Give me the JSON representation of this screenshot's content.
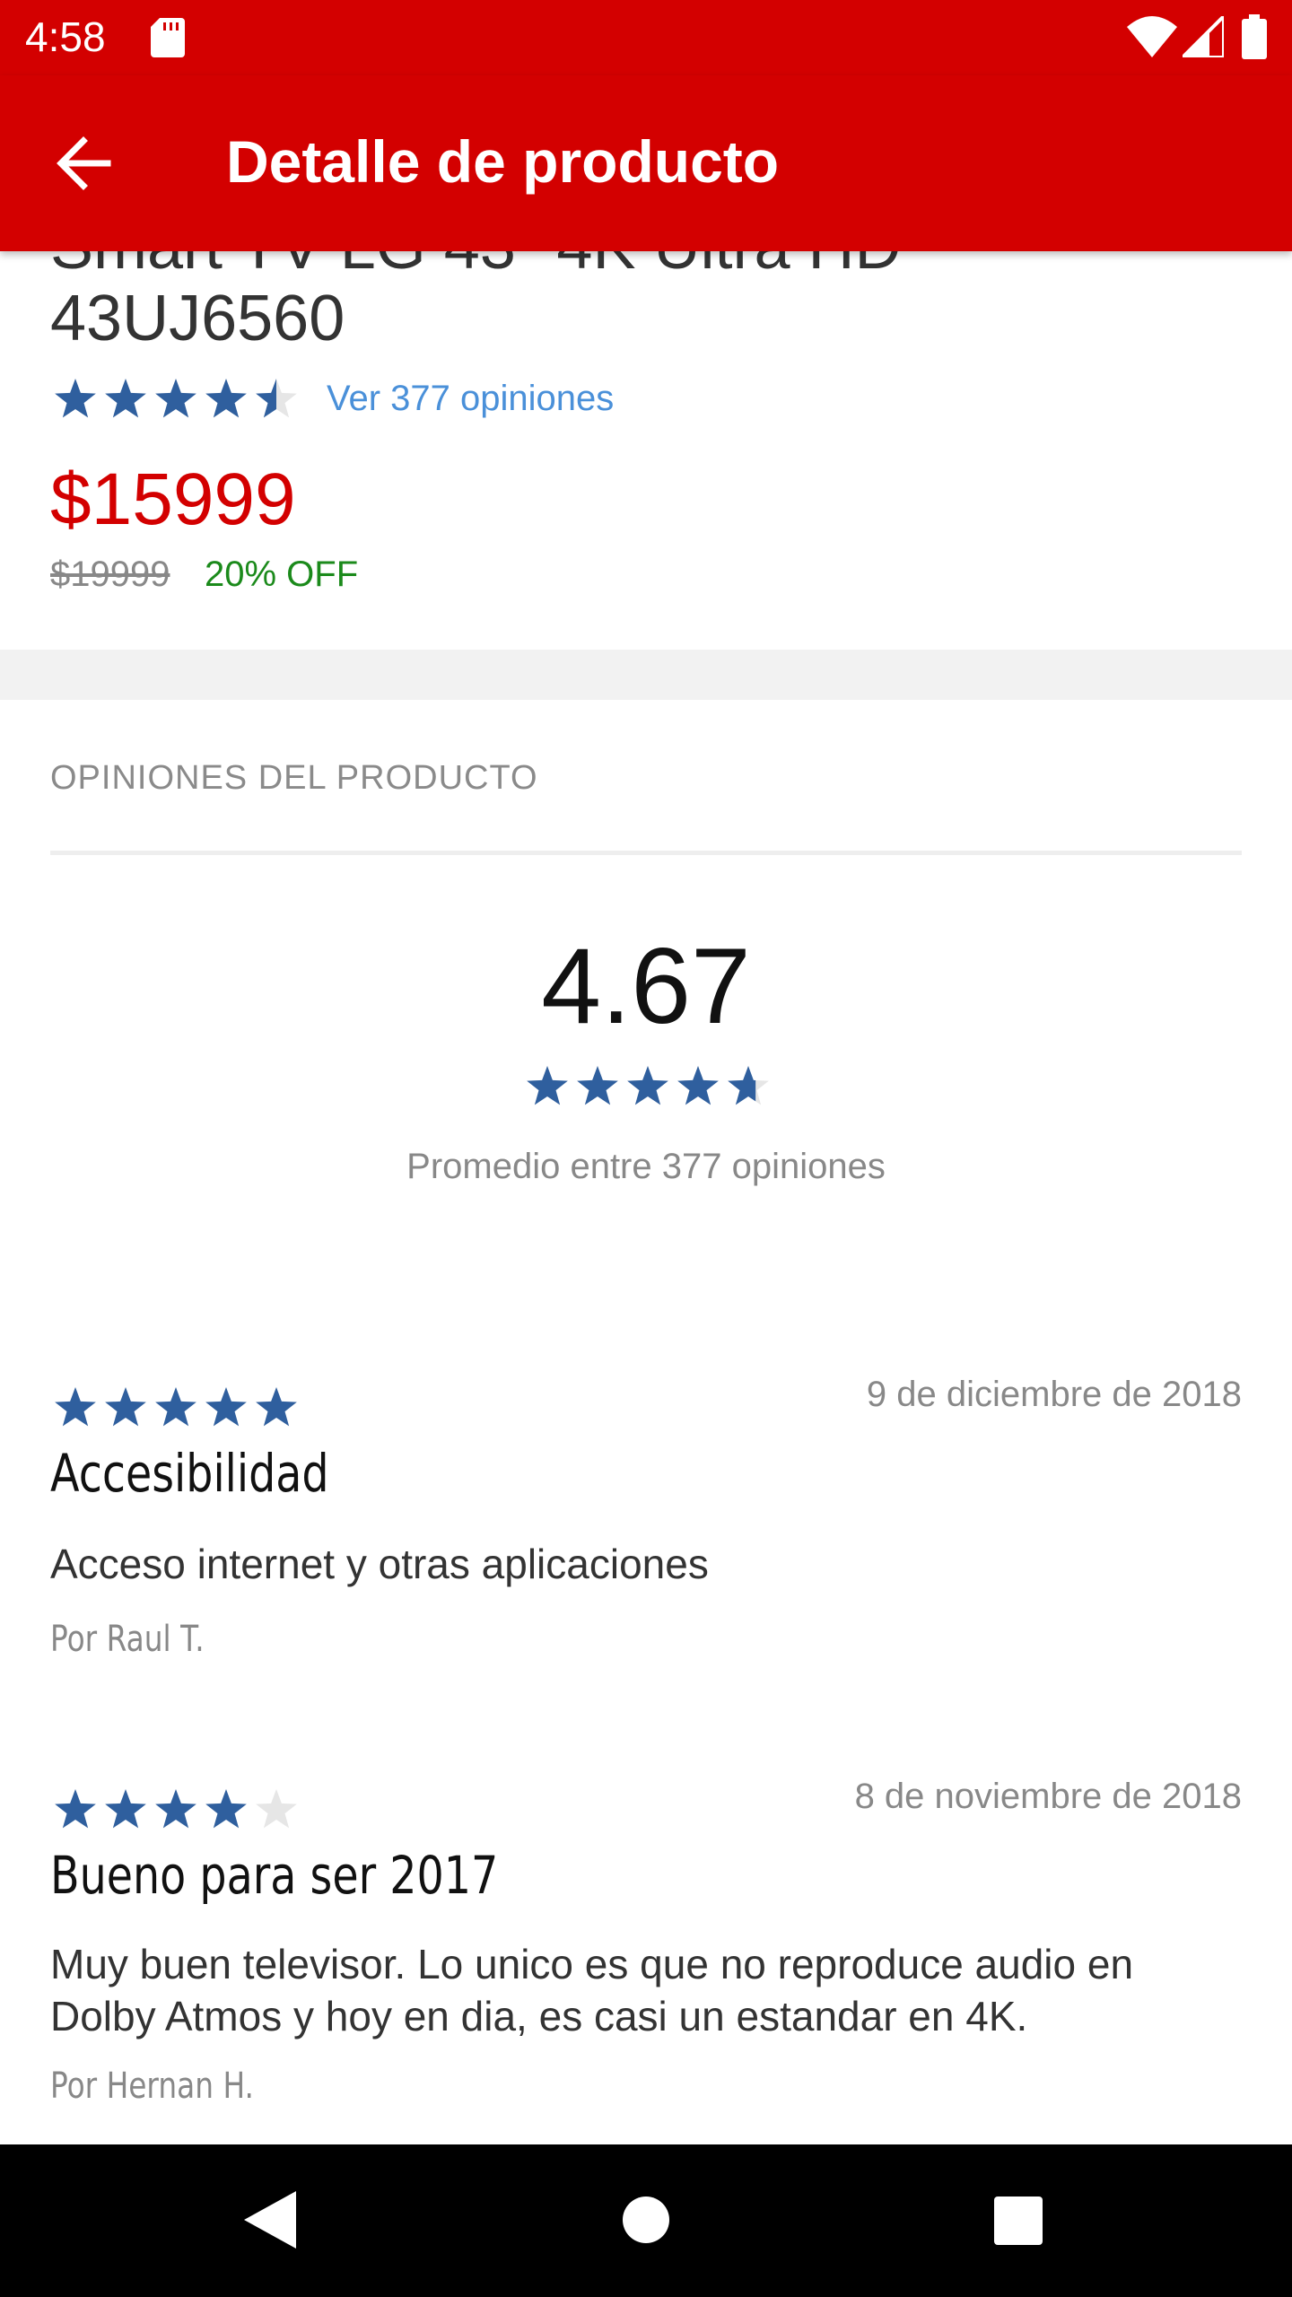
{
  "status_bar": {
    "time": "4:58"
  },
  "app_bar": {
    "title": "Detalle de producto"
  },
  "product": {
    "title_partial": "Smart TV LG 43\" 4K Ultra HD",
    "model": "43UJ6560",
    "rating": 4.5,
    "reviews_link": "Ver 377 opiniones",
    "price": "$15999",
    "old_price": "$19999",
    "discount": "20% OFF"
  },
  "reviews_section": {
    "heading": "OPINIONES DEL PRODUCTO",
    "average": "4.67",
    "average_rating": 4.67,
    "caption": "Promedio entre 377 opiniones"
  },
  "reviews": [
    {
      "rating": 5,
      "date": "9 de diciembre de 2018",
      "title": "Accesibilidad",
      "body": "Acceso internet y otras aplicaciones",
      "author": "Por Raul T."
    },
    {
      "rating": 4,
      "date": "8 de noviembre de 2018",
      "title": "Bueno para ser 2017",
      "body": "Muy buen televisor. Lo unico es que no reproduce audio en Dolby Atmos y hoy en dia, es casi un estandar en 4K.",
      "author": "Por Hernan H."
    }
  ],
  "colors": {
    "brand_red": "#d30000",
    "star_blue": "#2f5f9e",
    "star_empty": "#e6e6e6",
    "link_blue": "#4a90d9",
    "discount_green": "#1b8a1b"
  },
  "icons": {
    "status": [
      "sd-card-icon",
      "wifi-icon",
      "signal-icon",
      "battery-icon"
    ],
    "app_bar": [
      "back-arrow-icon"
    ],
    "nav": [
      "nav-back-icon",
      "nav-home-icon",
      "nav-recents-icon"
    ]
  }
}
